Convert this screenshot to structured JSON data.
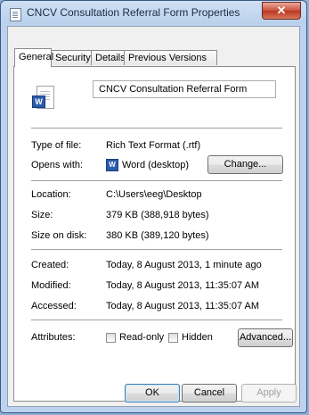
{
  "window": {
    "title": "CNCV Consultation Referral Form Properties",
    "close_glyph": "✕"
  },
  "tabs": [
    {
      "label": "General",
      "active": true
    },
    {
      "label": "Security",
      "active": false
    },
    {
      "label": "Details",
      "active": false
    },
    {
      "label": "Previous Versions",
      "active": false
    }
  ],
  "file": {
    "icon": "word-document-icon",
    "icon_badge": "W",
    "name": "CNCV Consultation Referral Form",
    "type_label": "Type of file:",
    "type_value": "Rich Text Format (.rtf)",
    "opens_label": "Opens with:",
    "opens_value": "Word (desktop)",
    "opens_icon_badge": "W",
    "change_button": "Change..."
  },
  "location": {
    "location_label": "Location:",
    "location_value": "C:\\Users\\eeg\\Desktop",
    "size_label": "Size:",
    "size_value": "379 KB (388,918 bytes)",
    "size_disk_label": "Size on disk:",
    "size_disk_value": "380 KB (389,120 bytes)"
  },
  "dates": {
    "created_label": "Created:",
    "created_value": "Today, 8 August 2013, 1 minute ago",
    "modified_label": "Modified:",
    "modified_value": "Today, 8 August 2013, 11:35:07 AM",
    "accessed_label": "Accessed:",
    "accessed_value": "Today, 8 August 2013, 11:35:07 AM"
  },
  "attributes": {
    "label": "Attributes:",
    "readonly_label": "Read-only",
    "readonly_checked": false,
    "hidden_label": "Hidden",
    "hidden_checked": false,
    "advanced_button": "Advanced..."
  },
  "footer": {
    "ok": "OK",
    "cancel": "Cancel",
    "apply": "Apply"
  },
  "colors": {
    "accent": "#2a5cae",
    "close": "#c94f3a"
  }
}
